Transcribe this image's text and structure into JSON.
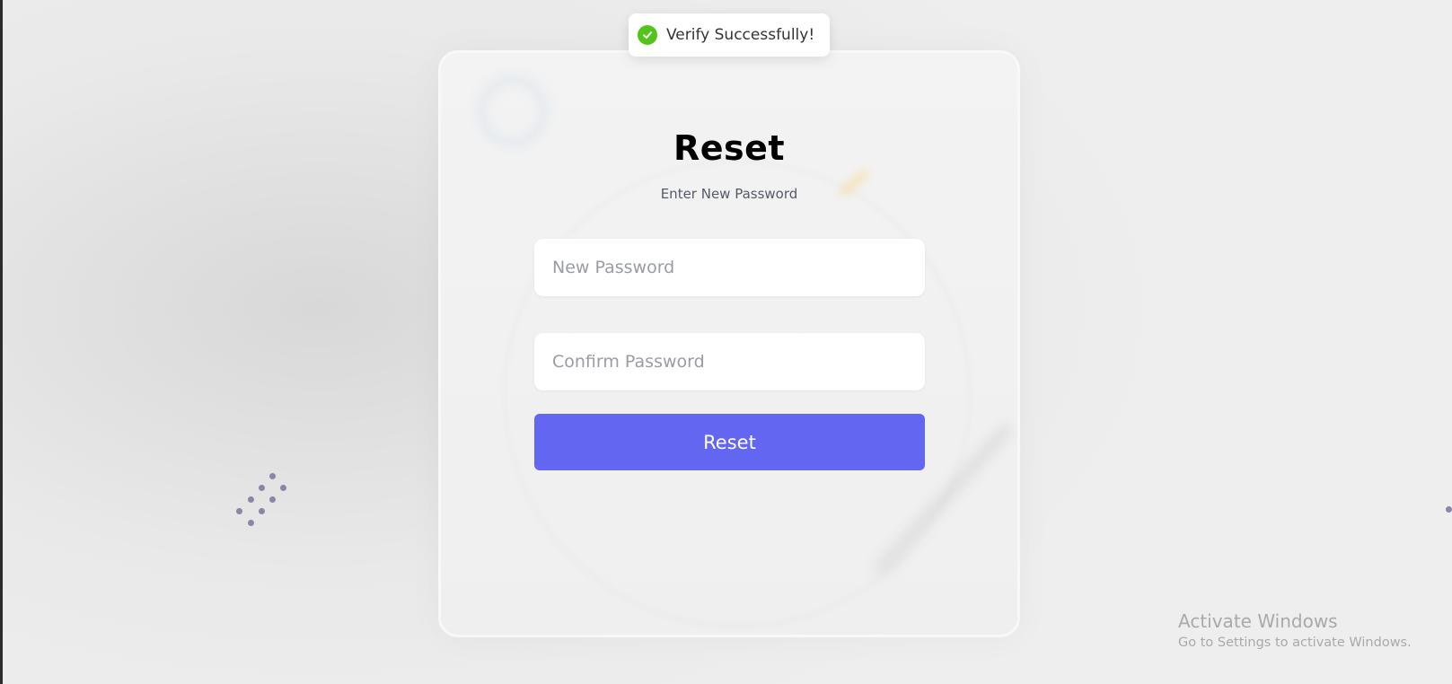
{
  "toast": {
    "message": "Verify Successfully!",
    "icon": "check-circle-icon",
    "icon_color": "#52c41a"
  },
  "form": {
    "title": "Reset",
    "subtitle": "Enter New Password",
    "new_password_placeholder": "New Password",
    "confirm_password_placeholder": "Confirm Password",
    "submit_label": "Reset",
    "accent_color": "#6366f1"
  },
  "watermark": {
    "title": "Activate Windows",
    "subtitle": "Go to Settings to activate Windows."
  }
}
